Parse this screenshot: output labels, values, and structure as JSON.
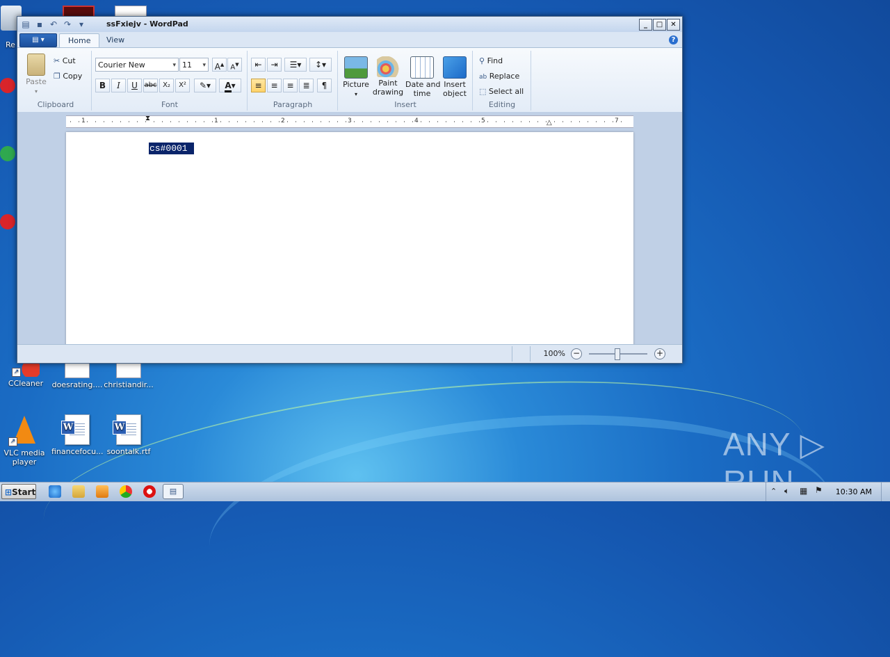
{
  "window": {
    "title": "ssFxiejv - WordPad"
  },
  "tabs": [
    {
      "label": "Home",
      "active": true
    },
    {
      "label": "View",
      "active": false
    }
  ],
  "ribbon": {
    "clipboard": {
      "label": "Clipboard",
      "paste": "Paste",
      "cut": "Cut",
      "copy": "Copy"
    },
    "font": {
      "label": "Font",
      "family": "Courier New",
      "size": "11",
      "bold": "B",
      "italic": "I",
      "underline": "U",
      "strike": "abc",
      "sub": "X₂",
      "sup": "X²"
    },
    "paragraph": {
      "label": "Paragraph"
    },
    "insert": {
      "label": "Insert",
      "picture": "Picture",
      "paint": "Paint\ndrawing",
      "paint1": "Paint",
      "paint2": "drawing",
      "date1": "Date and",
      "date2": "time",
      "obj1": "Insert",
      "obj2": "object"
    },
    "editing": {
      "label": "Editing",
      "find": "Find",
      "replace": "Replace",
      "selectall": "Select all"
    }
  },
  "ruler": {
    "numbers": [
      "1",
      "1",
      "2",
      "3",
      "4",
      "5",
      "7"
    ]
  },
  "document": {
    "text": "cs#0001"
  },
  "status": {
    "zoom": "100%"
  },
  "desktop": {
    "icons": [
      {
        "label": "CCleaner"
      },
      {
        "label": "doesrating...."
      },
      {
        "label": "christiandir..."
      },
      {
        "label": "VLC media player",
        "l1": "VLC media",
        "l2": "player"
      },
      {
        "label": "financefocu..."
      },
      {
        "label": "soontalk.rtf"
      }
    ],
    "fragment": "Re"
  },
  "taskbar": {
    "start": "Start",
    "clock": "10:30 AM"
  },
  "watermark": "ANY ▷ RUN",
  "colors": {
    "selection": "#0a246a",
    "accent": "#1b4f9c"
  }
}
